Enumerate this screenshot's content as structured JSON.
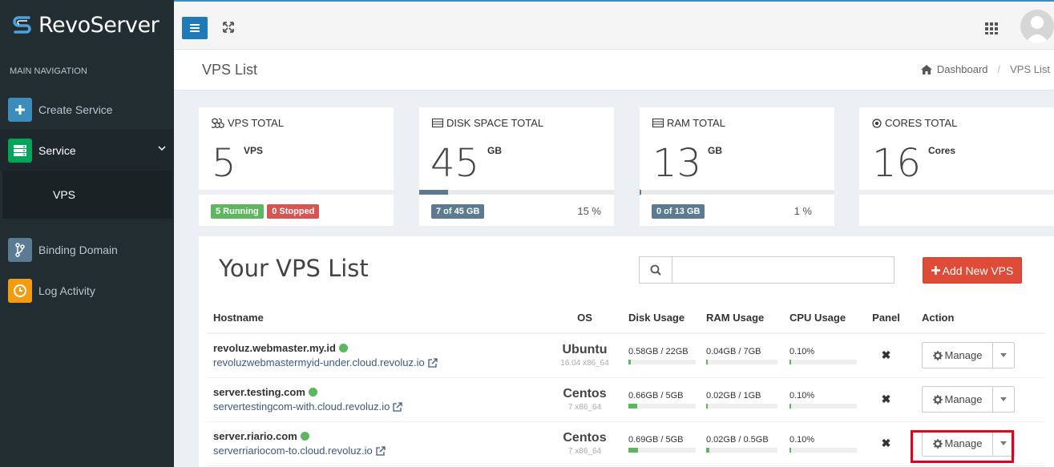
{
  "brand": {
    "name": "RevoServer"
  },
  "sidebar": {
    "header": "MAIN NAVIGATION",
    "items": [
      {
        "label": "Create Service",
        "icon": "plus-icon"
      },
      {
        "label": "Service",
        "icon": "server-icon"
      },
      {
        "label": "Binding Domain",
        "icon": "branch-icon"
      },
      {
        "label": "Log Activity",
        "icon": "clock-icon"
      }
    ],
    "sub_items": [
      {
        "label": "VPS"
      }
    ]
  },
  "content_header": {
    "title": "VPS List",
    "breadcrumb": [
      "Dashboard",
      "/",
      "VPS List"
    ]
  },
  "stats": {
    "vps": {
      "title": "VPS TOTAL",
      "value": "5",
      "unit": "VPS",
      "running": "5 Running",
      "stopped": "0 Stopped"
    },
    "disk": {
      "title": "DISK SPACE TOTAL",
      "value": "45",
      "unit": "GB",
      "badge": "7 of 45 GB",
      "percent": "15 %",
      "fill": 0.15
    },
    "ram": {
      "title": "RAM TOTAL",
      "value": "13",
      "unit": "GB",
      "badge": "0 of 13 GB",
      "percent": "1 %",
      "fill": 0.01
    },
    "cores": {
      "title": "CORES TOTAL",
      "value": "16",
      "unit": "Cores"
    }
  },
  "list": {
    "title": "Your VPS List",
    "search_placeholder": "",
    "add_button": "Add New VPS",
    "columns": [
      "Hostname",
      "OS",
      "Disk Usage",
      "RAM Usage",
      "CPU Usage",
      "Panel",
      "Action"
    ],
    "rows": [
      {
        "hostname": "revoluz.webmaster.my.id",
        "domain": "revoluzwebmastermyid-under.cloud.revoluz.io",
        "os": "Ubuntu",
        "os_version": "16.04 x86_64",
        "disk": "0.58GB / 22GB",
        "disk_fill": 0.03,
        "ram": "0.04GB / 7GB",
        "ram_fill": 0.01,
        "cpu": "0.10%",
        "cpu_fill": 0.0,
        "panel": "✖",
        "action": "Manage"
      },
      {
        "hostname": "server.testing.com",
        "domain": "servertestingcom-with.cloud.revoluz.io",
        "os": "Centos",
        "os_version": "7 x86_64",
        "disk": "0.66GB / 5GB",
        "disk_fill": 0.13,
        "ram": "0.02GB / 1GB",
        "ram_fill": 0.02,
        "cpu": "0.10%",
        "cpu_fill": 0.0,
        "panel": "✖",
        "action": "Manage"
      },
      {
        "hostname": "server.riario.com",
        "domain": "serverriariocom-to.cloud.revoluz.io",
        "os": "Centos",
        "os_version": "7 x86_64",
        "disk": "0.69GB / 5GB",
        "disk_fill": 0.14,
        "ram": "0.02GB / 0.5GB",
        "ram_fill": 0.04,
        "cpu": "0.10%",
        "cpu_fill": 0.0,
        "panel": "✖",
        "action": "Manage"
      }
    ]
  },
  "colors": {
    "sidebar": "#222d32",
    "accent": "#3c8dbc",
    "danger": "#dd4b39",
    "success": "#5cb85c"
  }
}
